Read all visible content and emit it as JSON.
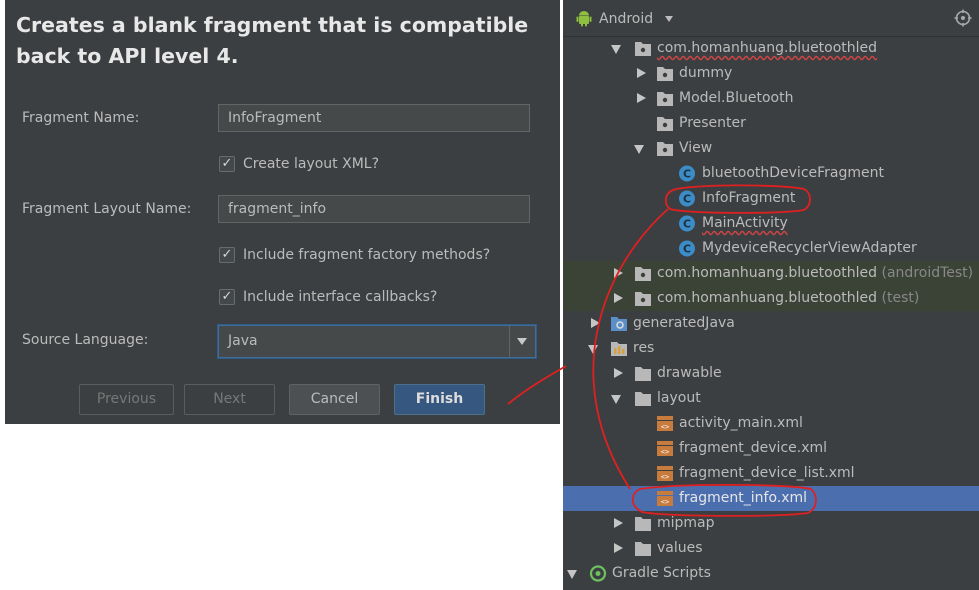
{
  "dialog": {
    "title": "Creates a blank fragment that is compatible back to API level 4.",
    "fragment_name_label": "Fragment Name:",
    "fragment_name_value": "InfoFragment",
    "create_layout_label": "Create layout XML?",
    "layout_name_label": "Fragment Layout Name:",
    "layout_name_value": "fragment_info",
    "factory_methods_label": "Include fragment factory methods?",
    "interface_callbacks_label": "Include interface callbacks?",
    "source_language_label": "Source Language:",
    "source_language_value": "Java",
    "buttons": {
      "previous": "Previous",
      "next": "Next",
      "cancel": "Cancel",
      "finish": "Finish"
    }
  },
  "panel": {
    "view_label": "Android",
    "tree": {
      "package_main": "com.homanhuang.bluetoothled",
      "dummy": "dummy",
      "model": "Model.Bluetooth",
      "presenter": "Presenter",
      "view": "View",
      "class_1": "bluetoothDeviceFragment",
      "class_2": "InfoFragment",
      "class_3": "MainActivity",
      "class_4": "MydeviceRecyclerViewAdapter",
      "package_android_test": "com.homanhuang.bluetoothled",
      "android_test_suffix": "(androidTest)",
      "package_test": "com.homanhuang.bluetoothled",
      "test_suffix": "(test)",
      "generated_java": "generatedJava",
      "res": "res",
      "drawable": "drawable",
      "layout": "layout",
      "xml_1": "activity_main.xml",
      "xml_2": "fragment_device.xml",
      "xml_3": "fragment_device_list.xml",
      "xml_4": "fragment_info.xml",
      "mipmap": "mipmap",
      "values": "values",
      "gradle_scripts": "Gradle Scripts"
    }
  },
  "colors": {
    "dialog_bg": "#3c3f41",
    "primary_button": "#365880",
    "selected_row": "#4b6eaf",
    "test_row_bg": "#3b4236",
    "annotation_red": "#e02020",
    "class_icon": "#3c8cc7"
  },
  "icons": [
    "checkmark-icon",
    "dropdown-arrow-icon",
    "android-icon",
    "locate-icon",
    "folder-icon",
    "package-icon",
    "class-icon",
    "layout-xml-icon",
    "gradle-icon"
  ]
}
